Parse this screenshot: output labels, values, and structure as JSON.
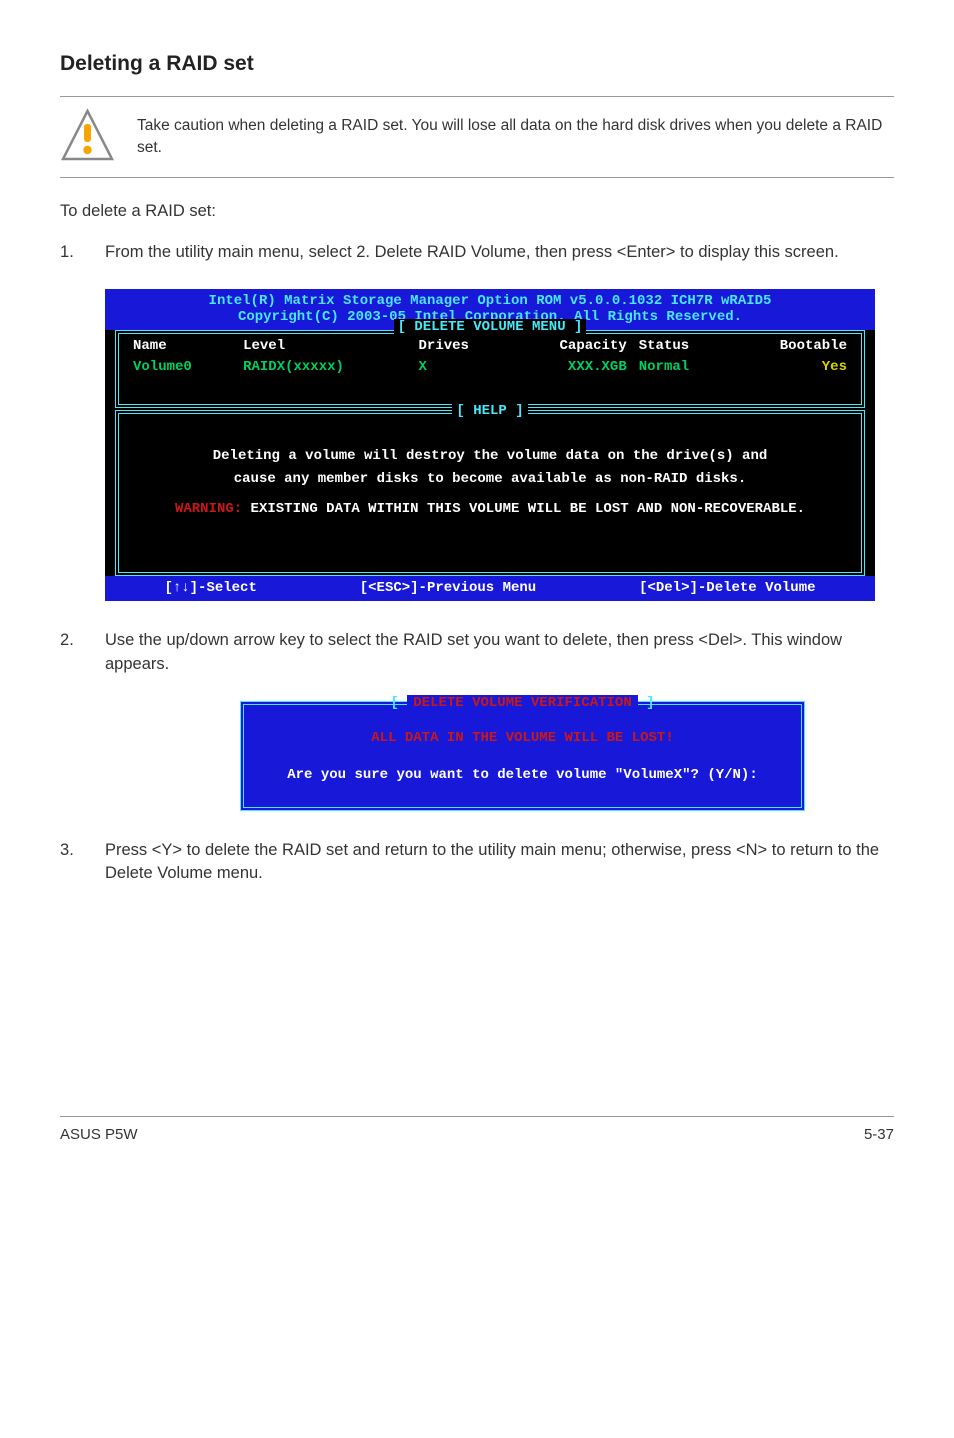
{
  "heading": "Deleting a RAID set",
  "callout": {
    "text": "Take caution when deleting a RAID set. You will lose all data on the hard disk drives when you delete a RAID set."
  },
  "intro": "To delete a RAID set:",
  "steps": {
    "s1": "From the utility main menu, select 2. Delete RAID Volume, then press <Enter> to display this screen.",
    "s2": "Use the up/down arrow key to select the RAID set you want to delete, then press <Del>. This window appears.",
    "s3": "Press <Y> to delete the RAID set and return to the utility main menu; otherwise, press <N> to return to the Delete Volume menu."
  },
  "bios": {
    "header1": "Intel(R) Matrix Storage Manager Option ROM v5.0.0.1032 ICH7R wRAID5",
    "header2": "Copyright(C) 2003-05 Intel Corporation. All Rights Reserved.",
    "sectionTitle": "[ DELETE VOLUME MENU ]",
    "cols": {
      "name": "Name",
      "level": "Level",
      "drives": "Drives",
      "capacity": "Capacity",
      "status": "Status",
      "bootable": "Bootable"
    },
    "row": {
      "name": "Volume0",
      "level": "RAIDX(xxxxx)",
      "drives": "X",
      "capacity": "XXX.XGB",
      "status": "Normal",
      "bootable": "Yes"
    },
    "helpTitle": "[ HELP ]",
    "help1": "Deleting a volume will destroy the volume data on the drive(s) and",
    "help2": "cause any member disks to become available as non-RAID disks.",
    "warnLabel": "WARNING:",
    "warnText": " EXISTING DATA WITHIN THIS VOLUME WILL BE LOST AND NON-RECOVERABLE.",
    "foot": {
      "select": "[↑↓]-Select",
      "prev": "[<ESC>]-Previous Menu",
      "del": "[<Del>]-Delete Volume"
    }
  },
  "modal": {
    "titleBracketL": "[ ",
    "title": "DELETE VOLUME VERIFICATION",
    "titleBracketR": " ]",
    "lost": "ALL DATA IN THE VOLUME WILL BE LOST!",
    "question": "Are you sure you want to delete volume \"VolumeX\"? (Y/N):"
  },
  "footer": {
    "left": "ASUS P5W",
    "right": "5-37"
  }
}
